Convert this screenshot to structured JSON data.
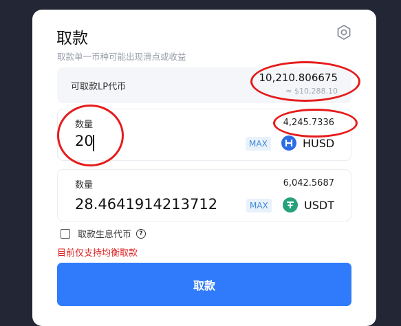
{
  "modal": {
    "title": "取款",
    "subtitle": "取款单一币种可能出现滑点或收益",
    "settings_icon": "hexagon-gear-icon"
  },
  "lp": {
    "label": "可取款LP代币",
    "amount": "10,210.806675",
    "usd_value": "≈ $10,288.10"
  },
  "input1": {
    "label": "数量",
    "balance": "4,245.7336",
    "value": "20",
    "max_label": "MAX",
    "token_symbol": "HUSD",
    "token_icon": "husd-logo-icon"
  },
  "input2": {
    "label": "数量",
    "balance": "6,042.5687",
    "value": "28.4641914213712",
    "max_label": "MAX",
    "token_symbol": "USDT",
    "token_icon": "usdt-logo-icon"
  },
  "interest_option": {
    "label": "取款生息代币",
    "checked": false,
    "help_icon": "question-circle-icon"
  },
  "warning": "目前仅支持均衡取款",
  "submit_label": "取款",
  "colors": {
    "backdrop": "#232634",
    "primary_button": "#2f7bfb",
    "warning_text": "#dd1f1f",
    "annotation_circle": "#e61b1b",
    "husd": "#2b6de5",
    "usdt": "#26a17b"
  }
}
